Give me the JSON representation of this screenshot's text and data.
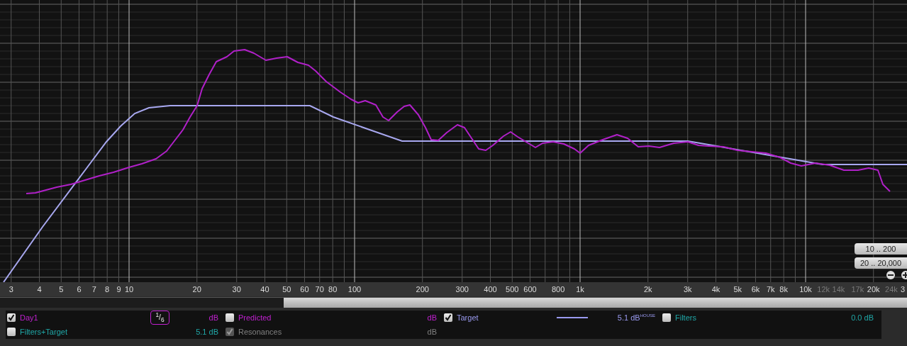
{
  "x_axis": {
    "ticks": [
      {
        "label": "3",
        "kind": "normal"
      },
      {
        "label": "4",
        "kind": "normal"
      },
      {
        "label": "5",
        "kind": "normal"
      },
      {
        "label": "6",
        "kind": "normal"
      },
      {
        "label": "7",
        "kind": "normal"
      },
      {
        "label": "8",
        "kind": "normal"
      },
      {
        "label": "9",
        "kind": "normal"
      },
      {
        "label": "10",
        "kind": "normal"
      },
      {
        "label": "20",
        "kind": "normal"
      },
      {
        "label": "30",
        "kind": "normal"
      },
      {
        "label": "40",
        "kind": "normal"
      },
      {
        "label": "50",
        "kind": "normal"
      },
      {
        "label": "60",
        "kind": "normal"
      },
      {
        "label": "70",
        "kind": "normal"
      },
      {
        "label": "80",
        "kind": "normal"
      },
      {
        "label": "100",
        "kind": "normal"
      },
      {
        "label": "200",
        "kind": "normal"
      },
      {
        "label": "300",
        "kind": "normal"
      },
      {
        "label": "400",
        "kind": "normal"
      },
      {
        "label": "500",
        "kind": "normal"
      },
      {
        "label": "600",
        "kind": "normal"
      },
      {
        "label": "800",
        "kind": "normal"
      },
      {
        "label": "1k",
        "kind": "normal"
      },
      {
        "label": "2k",
        "kind": "normal"
      },
      {
        "label": "3k",
        "kind": "normal"
      },
      {
        "label": "4k",
        "kind": "normal"
      },
      {
        "label": "5k",
        "kind": "normal"
      },
      {
        "label": "6k",
        "kind": "normal"
      },
      {
        "label": "7k",
        "kind": "normal"
      },
      {
        "label": "8k",
        "kind": "normal"
      },
      {
        "label": "10k",
        "kind": "normal"
      },
      {
        "label": "12k",
        "kind": "dim"
      },
      {
        "label": "14k",
        "kind": "dim"
      },
      {
        "label": "17k",
        "kind": "dim"
      },
      {
        "label": "20k",
        "kind": "normal"
      },
      {
        "label": "24k",
        "kind": "dim"
      },
      {
        "label": "3",
        "kind": "cut"
      }
    ]
  },
  "range_buttons": [
    "10 .. 200",
    "20 .. 20,000"
  ],
  "legend": [
    {
      "label": "Day1",
      "checked": true,
      "disabled": false,
      "color": "#c020d0",
      "kind": "smoothing",
      "badge": "$^{1}$/$_{6}$",
      "value": "dB"
    },
    {
      "label": "Predicted",
      "checked": false,
      "disabled": false,
      "color": "#c020d0",
      "value": "dB"
    },
    {
      "label": "Target",
      "checked": true,
      "disabled": false,
      "color": "#9a9af0",
      "kind": "line",
      "value": "5.1 dB",
      "note": "HOUSE"
    },
    {
      "label": "Filters",
      "checked": false,
      "disabled": false,
      "color": "#20a8a8",
      "value": "0.0 dB"
    },
    {
      "label": "Filters+Target",
      "checked": false,
      "disabled": false,
      "color": "#20a8a8",
      "value": "5.1 dB"
    },
    {
      "label": "Resonances",
      "checked": true,
      "disabled": true,
      "color": "#808080",
      "value": "dB"
    }
  ]
}
